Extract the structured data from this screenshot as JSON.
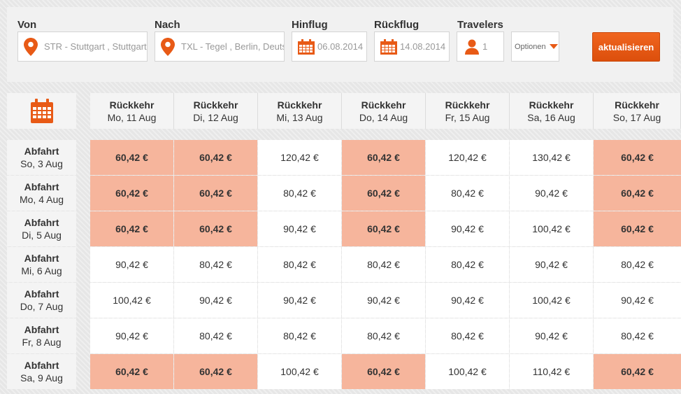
{
  "search": {
    "from": {
      "label": "Von",
      "value": "STR - Stuttgart  , Stuttgart,"
    },
    "to": {
      "label": "Nach",
      "value": "TXL - Tegel  , Berlin, Deuts"
    },
    "outbound": {
      "label": "Hinflug",
      "value": "06.08.2014"
    },
    "inbound": {
      "label": "Rückflug",
      "value": "14.08.2014"
    },
    "travelers": {
      "label": "Travelers",
      "value": "1"
    },
    "options_label": "Optionen",
    "update_label": "aktualisieren"
  },
  "colors": {
    "accent": "#e85a16",
    "cheapest": "#f6b59c"
  },
  "grid": {
    "return_label": "Rückkehr",
    "depart_label": "Abfahrt",
    "columns": [
      "Mo, 11 Aug",
      "Di, 12 Aug",
      "Mi, 13 Aug",
      "Do, 14 Aug",
      "Fr, 15 Aug",
      "Sa, 16 Aug",
      "So, 17 Aug"
    ],
    "rows": [
      {
        "date": "So, 3 Aug",
        "prices": [
          "60,42 €",
          "60,42 €",
          "120,42 €",
          "60,42 €",
          "120,42 €",
          "130,42 €",
          "60,42 €"
        ],
        "cheapest": [
          true,
          true,
          false,
          true,
          false,
          false,
          true
        ]
      },
      {
        "date": "Mo, 4 Aug",
        "prices": [
          "60,42 €",
          "60,42 €",
          "80,42 €",
          "60,42 €",
          "80,42 €",
          "90,42 €",
          "60,42 €"
        ],
        "cheapest": [
          true,
          true,
          false,
          true,
          false,
          false,
          true
        ]
      },
      {
        "date": "Di, 5 Aug",
        "prices": [
          "60,42 €",
          "60,42 €",
          "90,42 €",
          "60,42 €",
          "90,42 €",
          "100,42 €",
          "60,42 €"
        ],
        "cheapest": [
          true,
          true,
          false,
          true,
          false,
          false,
          true
        ]
      },
      {
        "date": "Mi, 6 Aug",
        "prices": [
          "90,42 €",
          "80,42 €",
          "80,42 €",
          "80,42 €",
          "80,42 €",
          "90,42 €",
          "80,42 €"
        ],
        "cheapest": [
          false,
          false,
          false,
          false,
          false,
          false,
          false
        ]
      },
      {
        "date": "Do, 7 Aug",
        "prices": [
          "100,42 €",
          "90,42 €",
          "90,42 €",
          "90,42 €",
          "90,42 €",
          "100,42 €",
          "90,42 €"
        ],
        "cheapest": [
          false,
          false,
          false,
          false,
          false,
          false,
          false
        ]
      },
      {
        "date": "Fr, 8 Aug",
        "prices": [
          "90,42 €",
          "80,42 €",
          "80,42 €",
          "80,42 €",
          "80,42 €",
          "90,42 €",
          "80,42 €"
        ],
        "cheapest": [
          false,
          false,
          false,
          false,
          false,
          false,
          false
        ]
      },
      {
        "date": "Sa, 9 Aug",
        "prices": [
          "60,42 €",
          "60,42 €",
          "100,42 €",
          "60,42 €",
          "100,42 €",
          "110,42 €",
          "60,42 €"
        ],
        "cheapest": [
          true,
          true,
          false,
          true,
          false,
          false,
          true
        ]
      }
    ]
  }
}
